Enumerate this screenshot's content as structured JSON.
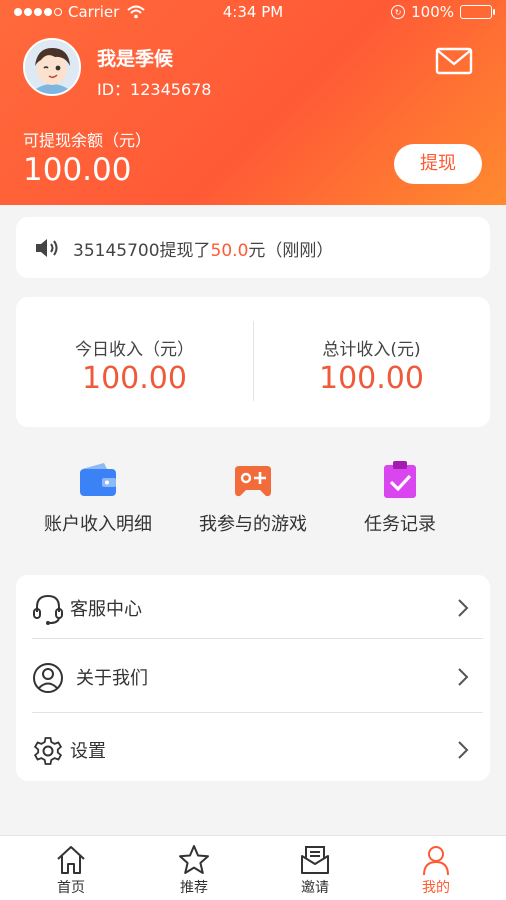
{
  "status_bar": {
    "carrier": "Carrier",
    "time": "4:34 PM",
    "battery": "100%"
  },
  "user": {
    "name": "我是季候",
    "id": "ID：12345678"
  },
  "balance": {
    "label": "可提现余额（元）",
    "value": "100.00",
    "withdraw_label": "提现"
  },
  "notice": {
    "prefix": "35145700提现了",
    "amount": "50.0",
    "suffix": "元（刚刚）"
  },
  "income": {
    "today_label": "今日收入（元）",
    "today_value": "100.00",
    "total_label": "总计收入(元)",
    "total_value": "100.00"
  },
  "quick_links": [
    {
      "label": "账户收入明细",
      "icon": "wallet-icon"
    },
    {
      "label": "我参与的游戏",
      "icon": "gamepad-icon"
    },
    {
      "label": "任务记录",
      "icon": "clipboard-check-icon"
    }
  ],
  "menu": [
    {
      "label": "客服中心",
      "icon": "headset-icon"
    },
    {
      "label": "关于我们",
      "icon": "user-circle-icon"
    },
    {
      "label": "设置",
      "icon": "gear-icon"
    }
  ],
  "tabs": [
    {
      "label": "首页",
      "icon": "home-icon"
    },
    {
      "label": "推荐",
      "icon": "star-icon"
    },
    {
      "label": "邀请",
      "icon": "invite-mail-icon"
    },
    {
      "label": "我的",
      "icon": "person-icon",
      "active": true
    }
  ],
  "colors": {
    "accent": "#ff5b33",
    "wallet": "#3b82f6",
    "gamepad": "#f26b3a",
    "clipboard": "#d946ef"
  }
}
